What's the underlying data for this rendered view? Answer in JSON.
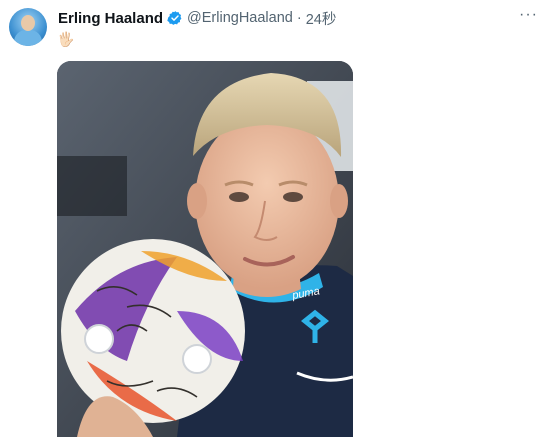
{
  "author": {
    "name": "Erling Haaland",
    "handle": "@ErlingHaaland",
    "separator": "·",
    "time": "24秒"
  },
  "tweet": {
    "text": "🖐🏻"
  },
  "icons": {
    "verified": "verified-badge-icon",
    "more": "more-options-icon"
  },
  "more_label": "···",
  "colors": {
    "verified_blue": "#1d9bf0",
    "name_text": "#0f1419",
    "secondary_text": "#536471"
  }
}
